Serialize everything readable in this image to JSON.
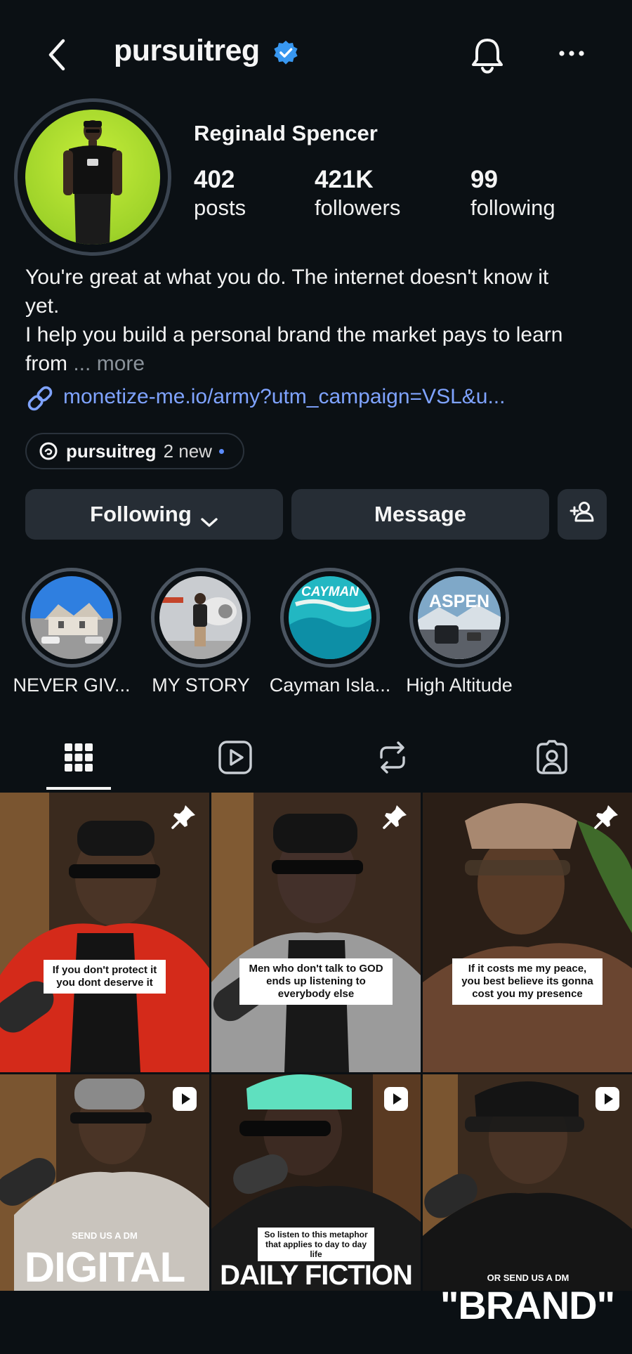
{
  "header": {
    "username": "pursuitreg",
    "verified": true,
    "accent_color": "#3897f0"
  },
  "profile": {
    "display_name": "Reginald Spencer",
    "stats": [
      {
        "value": "402",
        "label": "posts"
      },
      {
        "value": "421K",
        "label": "followers"
      },
      {
        "value": "99",
        "label": "following"
      }
    ],
    "bio_line1": "You're great at what you do. The internet doesn't know it",
    "bio_line2": "yet.",
    "bio_line3": "I help you build a personal brand the market pays to learn",
    "bio_line4": "from",
    "bio_ellipsis": "...",
    "bio_more": "more",
    "link": "monetize-me.io/army?utm_campaign=VSL&u...",
    "link_color": "#7fa3ff"
  },
  "threads": {
    "name": "pursuitreg",
    "new_label": "2 new"
  },
  "actions": {
    "following_label": "Following",
    "message_label": "Message"
  },
  "highlights": [
    {
      "label": "NEVER GIV..."
    },
    {
      "label": "MY STORY"
    },
    {
      "label": "Cayman Isla...",
      "overlay": "CAYMAN"
    },
    {
      "label": "High Altitude",
      "overlay": "ASPEN"
    }
  ],
  "tabs": [
    {
      "name": "grid",
      "icon": "grid-icon",
      "selected": true
    },
    {
      "name": "reels",
      "icon": "reels-icon",
      "selected": false
    },
    {
      "name": "reposts",
      "icon": "repost-icon",
      "selected": false
    },
    {
      "name": "tagged",
      "icon": "tagged-icon",
      "selected": false
    }
  ],
  "posts": [
    {
      "type": "pinned",
      "caption": "If you don't protect it you dont deserve it"
    },
    {
      "type": "pinned",
      "caption": "Men who don't talk to GOD ends up listening to everybody else"
    },
    {
      "type": "pinned",
      "caption": "If it costs me my peace, you best believe its gonna cost you my presence"
    },
    {
      "type": "reel",
      "small": "SEND US A DM",
      "big": "DIGITAL"
    },
    {
      "type": "reel",
      "small": "So listen to this metaphor that applies to day to day life",
      "big": "DAILY FICTION"
    },
    {
      "type": "reel",
      "small": "OR SEND US A DM",
      "big": "\"BRAND\""
    }
  ]
}
